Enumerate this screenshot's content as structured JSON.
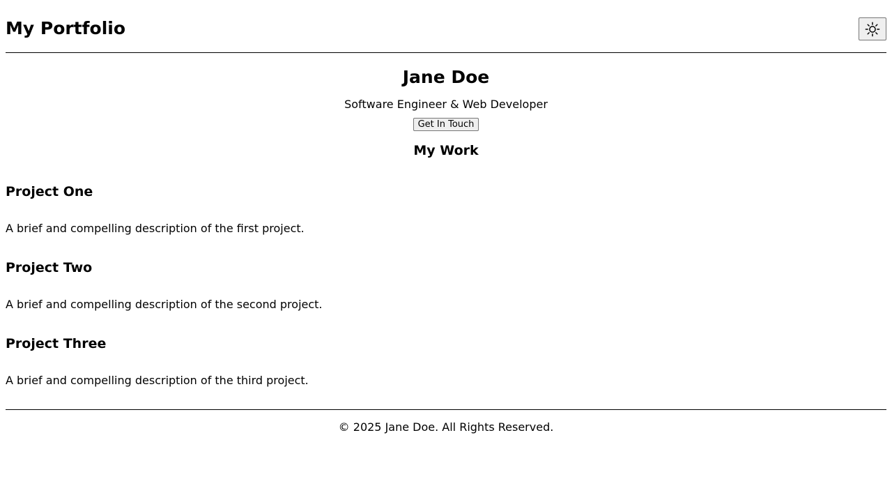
{
  "header": {
    "site_title": "My Portfolio",
    "theme_toggle_icon": "sun-icon"
  },
  "hero": {
    "name": "Jane Doe",
    "tagline": "Software Engineer & Web Developer",
    "cta_label": "Get In Touch"
  },
  "work": {
    "heading": "My Work",
    "projects": [
      {
        "title": "Project One",
        "description": "A brief and compelling description of the first project."
      },
      {
        "title": "Project Two",
        "description": "A brief and compelling description of the second project."
      },
      {
        "title": "Project Three",
        "description": "A brief and compelling description of the third project."
      }
    ]
  },
  "footer": {
    "copyright": "© 2025 Jane Doe. All Rights Reserved."
  }
}
